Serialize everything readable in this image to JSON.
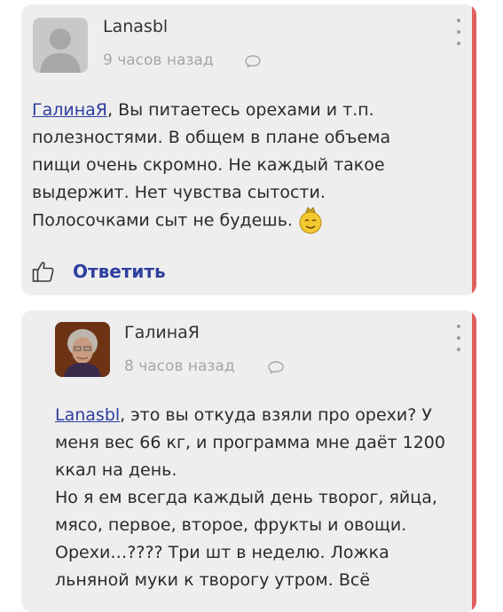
{
  "comments": [
    {
      "author": "Lanasbl",
      "time": "9 часов назад",
      "mention": "ГалинаЯ",
      "lines": [
        ", Вы питаетесь орехами и т.п.",
        "полезностями. В общем в плане объема",
        "пищи очень скромно. Не каждый такое",
        "выдержит. Нет чувства сытости.",
        "Полосочками сыт не будешь."
      ],
      "reply_label": "Ответить"
    },
    {
      "author": "ГалинаЯ",
      "time": "8 часов назад",
      "mention": "Lanasbl",
      "lines": [
        ", это вы откуда взяли про орехи? У",
        "меня вес 66 кг, и программа мне даёт 1200",
        "ккал на день.",
        "Но я ем всегда каждый день творог, яйца,",
        "мясо, первое, второе, фрукты и овощи.",
        "Орехи…???? Три шт в неделю. Ложка",
        "льняной муки к творогу утром. Всё"
      ]
    }
  ],
  "icons": {
    "kebab": "more-vertical-icon",
    "bubble": "comment-bubble-icon",
    "like": "thumbs-up-icon",
    "smiley": "smiley-emoticon-icon"
  },
  "colors": {
    "accent_bar": "#e25f5f",
    "link": "#2e3f9e",
    "card_bg": "#eeeeef"
  }
}
